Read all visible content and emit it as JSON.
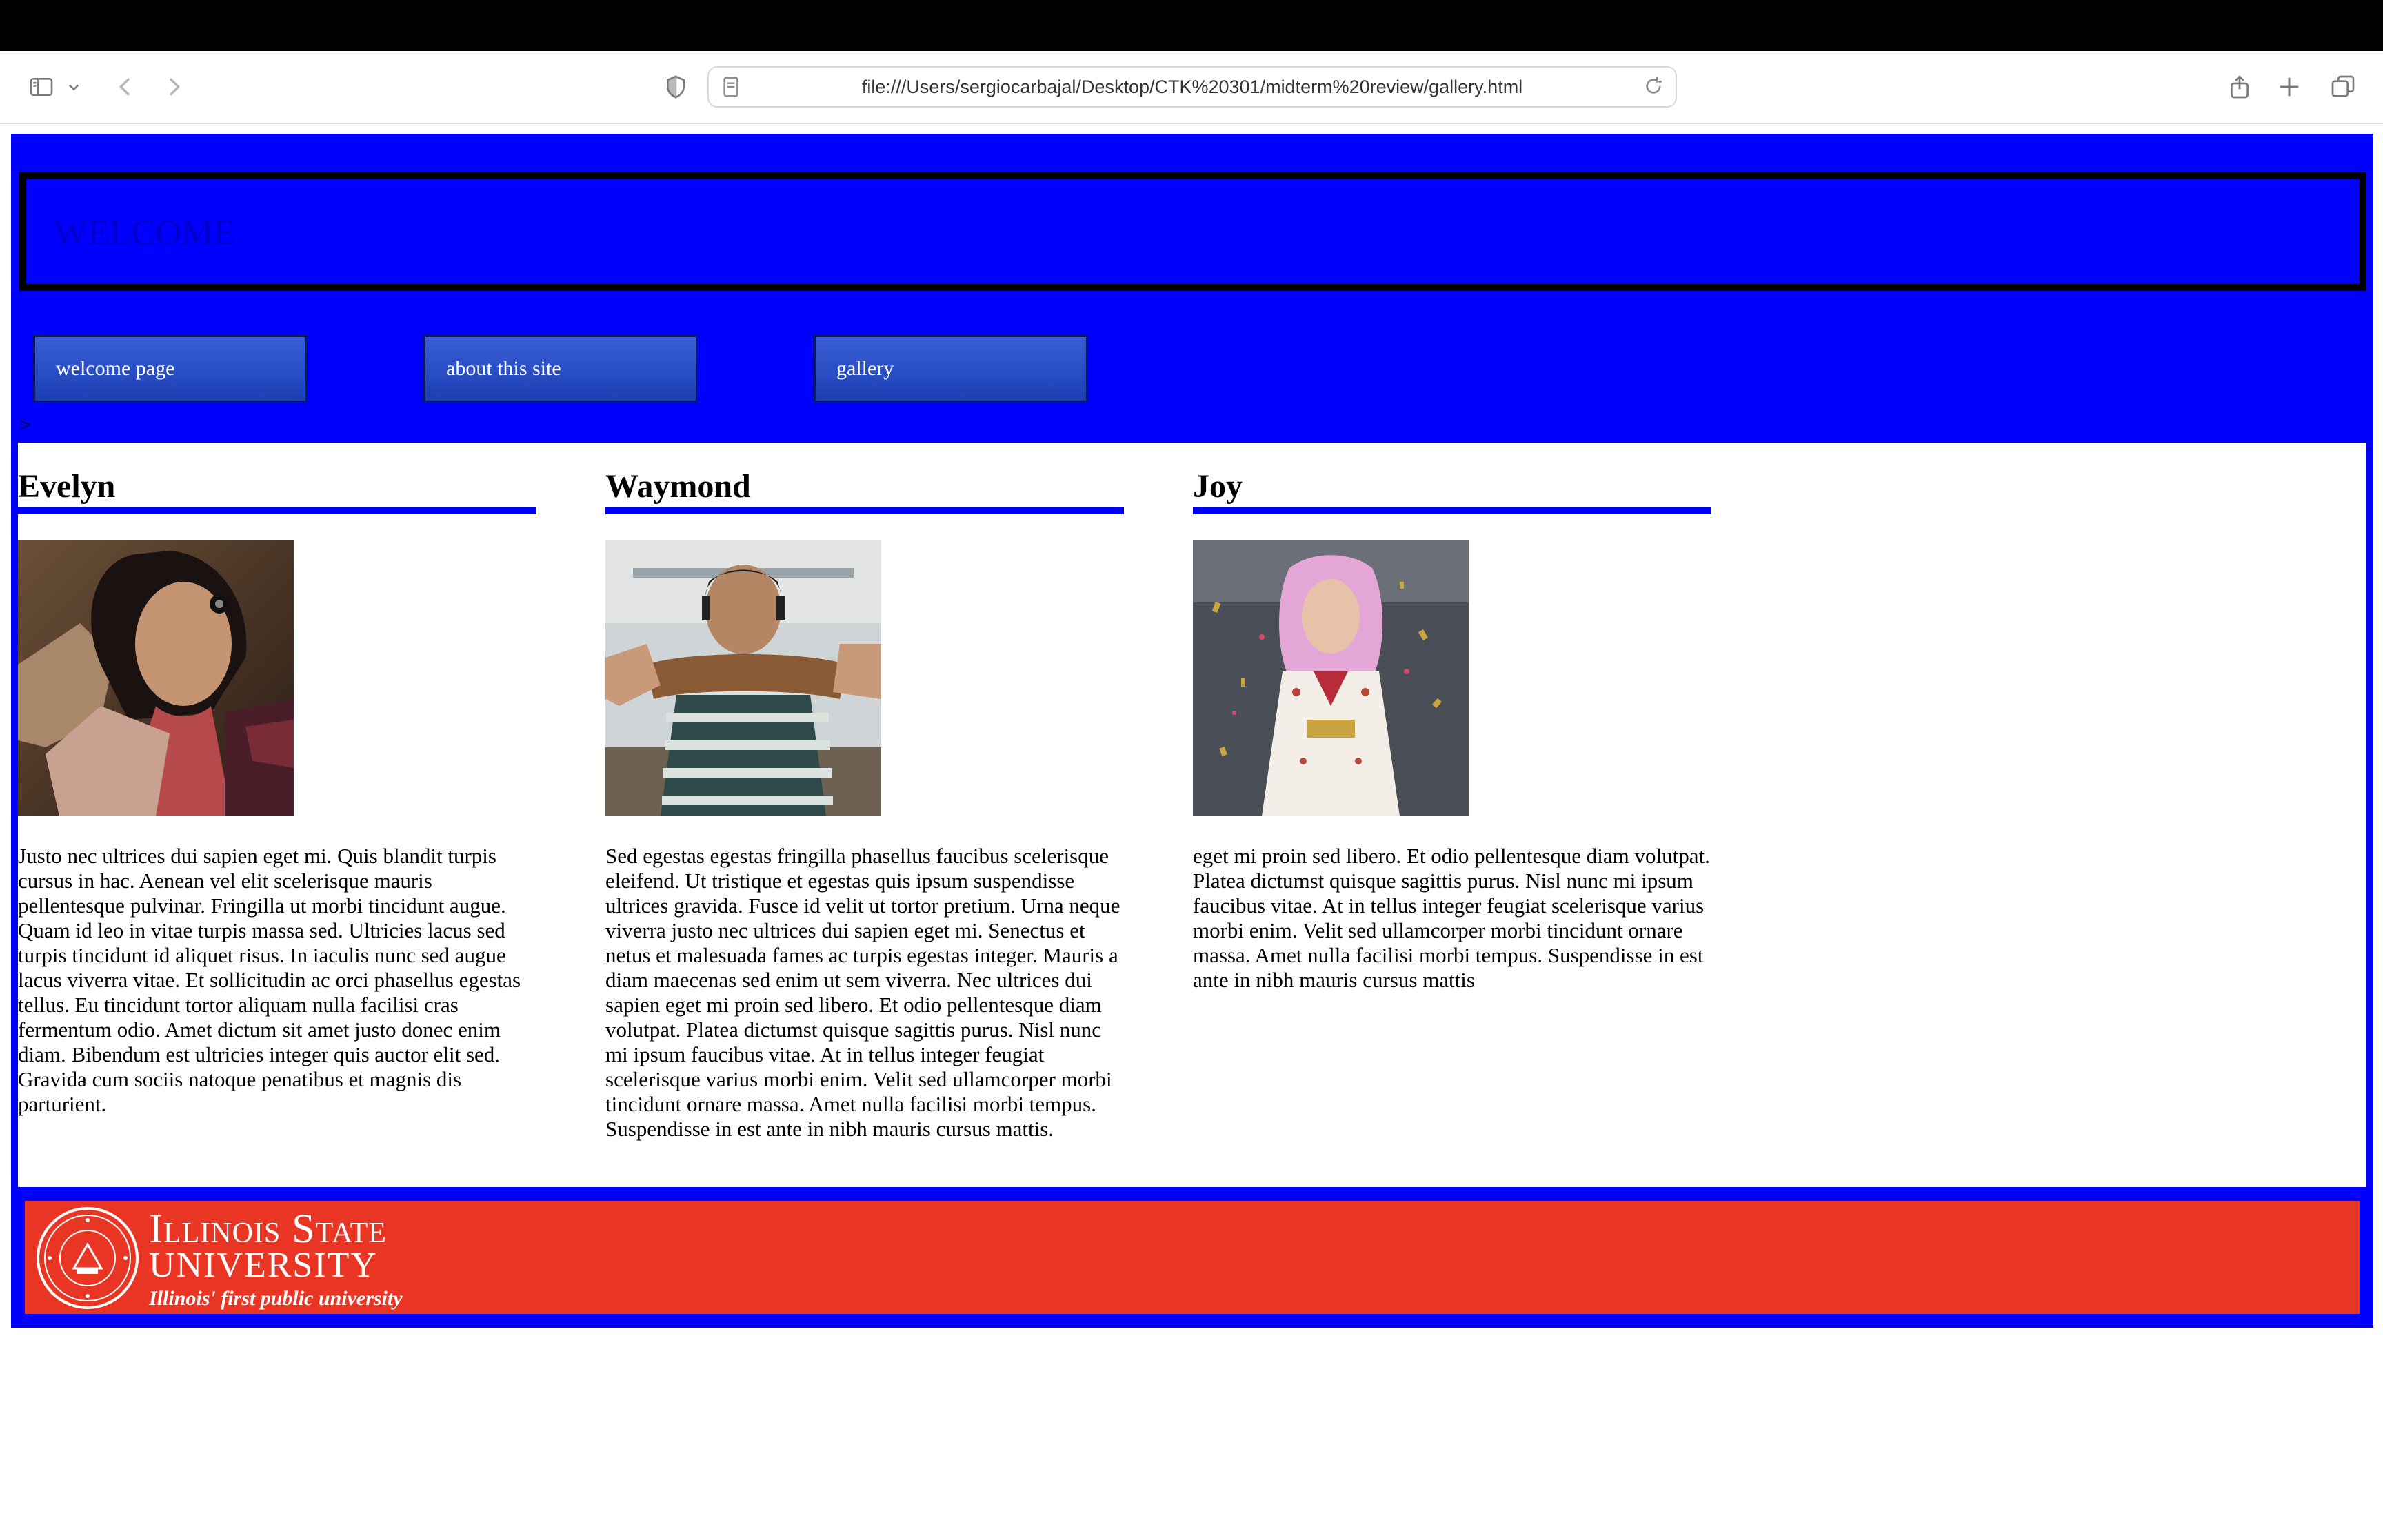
{
  "browser": {
    "url": "file:///Users/sergiocarbajal/Desktop/CTK%20301/midterm%20review/gallery.html"
  },
  "header": {
    "text": "WELCOME"
  },
  "nav": {
    "items": [
      {
        "label": "welcome page"
      },
      {
        "label": "about this site"
      },
      {
        "label": "gallery"
      }
    ]
  },
  "stray_text": ">",
  "gallery": {
    "cards": [
      {
        "name": "Evelyn",
        "image": "evelyn-photo",
        "text": "Justo nec ultrices dui sapien eget mi. Quis blandit turpis cursus in hac. Aenean vel elit scelerisque mauris pellentesque pulvinar. Fringilla ut morbi tincidunt augue. Quam id leo in vitae turpis massa sed. Ultricies lacus sed turpis tincidunt id aliquet risus. In iaculis nunc sed augue lacus viverra vitae. Et sollicitudin ac orci phasellus egestas tellus. Eu tincidunt tortor aliquam nulla facilisi cras fermentum odio. Amet dictum sit amet justo donec enim diam. Bibendum est ultricies integer quis auctor elit sed. Gravida cum sociis natoque penatibus et magnis dis parturient."
      },
      {
        "name": "Waymond",
        "image": "waymond-photo",
        "text": "Sed egestas egestas fringilla phasellus faucibus scelerisque eleifend. Ut tristique et egestas quis ipsum suspendisse ultrices gravida. Fusce id velit ut tortor pretium. Urna neque viverra justo nec ultrices dui sapien eget mi. Senectus et netus et malesuada fames ac turpis egestas integer. Mauris a diam maecenas sed enim ut sem viverra. Nec ultrices dui sapien eget mi proin sed libero. Et odio pellentesque diam volutpat. Platea dictumst quisque sagittis purus. Nisl nunc mi ipsum faucibus vitae. At in tellus integer feugiat scelerisque varius morbi enim. Velit sed ullamcorper morbi tincidunt ornare massa. Amet nulla facilisi morbi tempus. Suspendisse in est ante in nibh mauris cursus mattis."
      },
      {
        "name": "Joy",
        "image": "joy-photo",
        "text": "eget mi proin sed libero. Et odio pellentesque diam volutpat. Platea dictumst quisque sagittis purus. Nisl nunc mi ipsum faucibus vitae. At in tellus integer feugiat scelerisque varius morbi enim. Velit sed ullamcorper morbi tincidunt ornare massa. Amet nulla facilisi morbi tempus. Suspendisse in est ante in nibh mauris cursus mattis"
      }
    ]
  },
  "footer": {
    "line1": "Illinois State",
    "line2": "University",
    "tagline": "Illinois' first public university"
  },
  "colors": {
    "page_bg": "#0000ff",
    "footer_bg": "#e93524",
    "nav_button": "#2a4fc8"
  }
}
